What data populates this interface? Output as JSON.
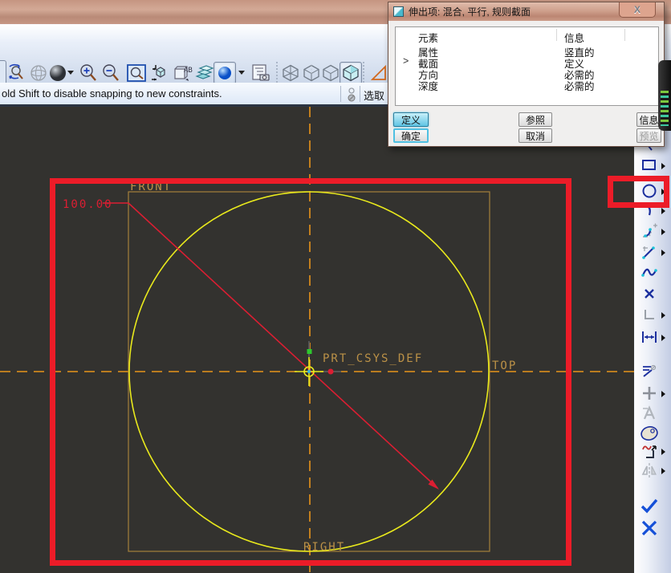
{
  "window": {
    "accent_red": "#ec1c28",
    "titlebar_color": "#c59581"
  },
  "toolbar": {
    "saved_views_glyph": "AB",
    "tools": [
      "repaint",
      "wireframe-sphere",
      "shaded-sphere",
      "zoom-in",
      "zoom-out",
      "zoom-fit",
      "reorient",
      "saved-views",
      "layers",
      "render-style",
      "model-tree",
      "wireframe-view",
      "hidden-line-view",
      "no-hidden-view",
      "shaded-view",
      "datum-planes"
    ]
  },
  "message_bar": {
    "text": "old Shift to disable snapping to new constraints.",
    "select_label": "选取"
  },
  "dialog": {
    "title": "伸出项: 混合, 平行, 规则截面",
    "close_glyph": "X",
    "columns": {
      "element": "元素",
      "info": "信息"
    },
    "rows": [
      {
        "element": "属性",
        "info": "竖直的",
        "marker": ""
      },
      {
        "element": "截面",
        "info": "定义",
        "marker": ">"
      },
      {
        "element": "方向",
        "info": "必需的",
        "marker": ""
      },
      {
        "element": "深度",
        "info": "必需的",
        "marker": ""
      }
    ],
    "buttons": {
      "define": "定义",
      "refs": "参照",
      "info": "信息",
      "ok": "确定",
      "cancel": "取消",
      "preview": "预览"
    }
  },
  "sketch": {
    "dimension_value": "100.00",
    "labels": {
      "front": "FRONT",
      "top": "TOP",
      "right": "RIGHT",
      "csys": "PRT_CSYS_DEF"
    },
    "colors": {
      "background": "#33322f",
      "circle": "#e9e91c",
      "datum": "#b08b42",
      "centerline": "#e8941a",
      "dimension": "#dc1e32"
    }
  },
  "sidebar": {
    "tools": [
      "line",
      "rectangle",
      "circle",
      "arc",
      "fillet",
      "chamfer",
      "spline",
      "point",
      "coordinate-system",
      "dimension",
      "modify-dimensions",
      "constraints",
      "text",
      "palette",
      "trim",
      "mirror",
      "done",
      "cancel"
    ]
  }
}
